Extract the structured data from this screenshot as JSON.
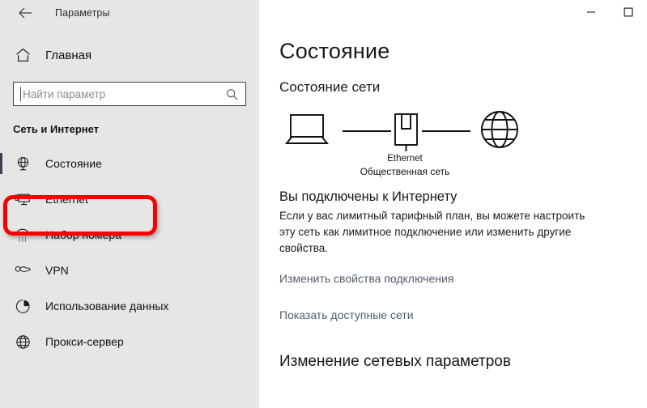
{
  "titlebar": {
    "back_icon": "back-arrow-icon",
    "app_title": "Параметры",
    "minimize_label": "—",
    "maximize_label": "□"
  },
  "sidebar": {
    "home": {
      "icon": "home-icon",
      "label": "Главная"
    },
    "search": {
      "placeholder": "Найти параметр",
      "value": "",
      "icon": "search-icon"
    },
    "group_header": "Сеть и Интернет",
    "items": [
      {
        "label": "Состояние",
        "icon": "network-status-icon",
        "selected": true
      },
      {
        "label": "Ethernet",
        "icon": "ethernet-monitor-icon",
        "selected": false
      },
      {
        "label": "Набор номера",
        "icon": "dial-up-phone-icon",
        "selected": false
      },
      {
        "label": "VPN",
        "icon": "vpn-key-icon",
        "selected": false
      },
      {
        "label": "Использование данных",
        "icon": "data-usage-pie-icon",
        "selected": false
      },
      {
        "label": "Прокси-сервер",
        "icon": "proxy-globe-icon",
        "selected": false
      }
    ],
    "annotation": {
      "target": "Ethernet",
      "color": "#f60000"
    }
  },
  "main": {
    "page_title": "Состояние",
    "section_title": "Состояние сети",
    "diagram": {
      "device_icon": "laptop-icon",
      "adapter_icon": "ethernet-port-icon",
      "internet_icon": "globe-icon",
      "adapter_label": "Ethernet",
      "network_type_label": "Общественная сеть"
    },
    "connected_title": "Вы подключены к Интернету",
    "connected_desc": "Если у вас лимитный тарифный план, вы можете настроить эту сеть как лимитное подключение или изменить другие свойства.",
    "links": [
      "Изменить свойства подключения",
      "Показать доступные сети"
    ],
    "bottom_heading": "Изменение сетевых параметров"
  }
}
